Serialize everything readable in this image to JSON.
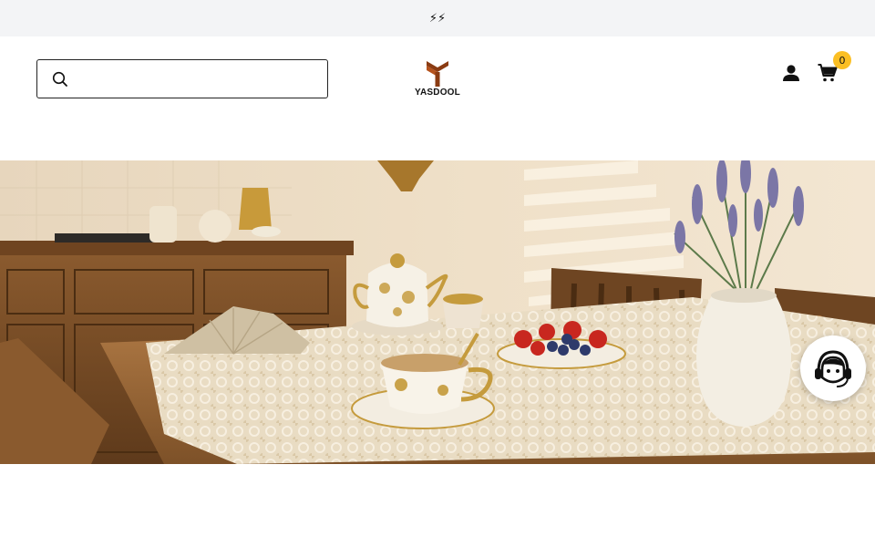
{
  "announcement": {
    "text": "⚡⚡"
  },
  "search": {
    "placeholder": ""
  },
  "logo": {
    "text": "YASDOOL"
  },
  "header_icons": {
    "account_icon": "user-icon",
    "cart_icon": "cart-icon",
    "cart_count": "0"
  },
  "nav": {
    "items": [
      "",
      "",
      "",
      ""
    ]
  },
  "hero": {
    "image": "dining-table-tea-set-lavender"
  },
  "support": {
    "icon": "customer-support-icon"
  },
  "section": {
    "title": ""
  },
  "colors": {
    "announcement_bg": "#f3f4f6",
    "badge": "#fbbf24",
    "logo_brown": "#8a3b12"
  }
}
